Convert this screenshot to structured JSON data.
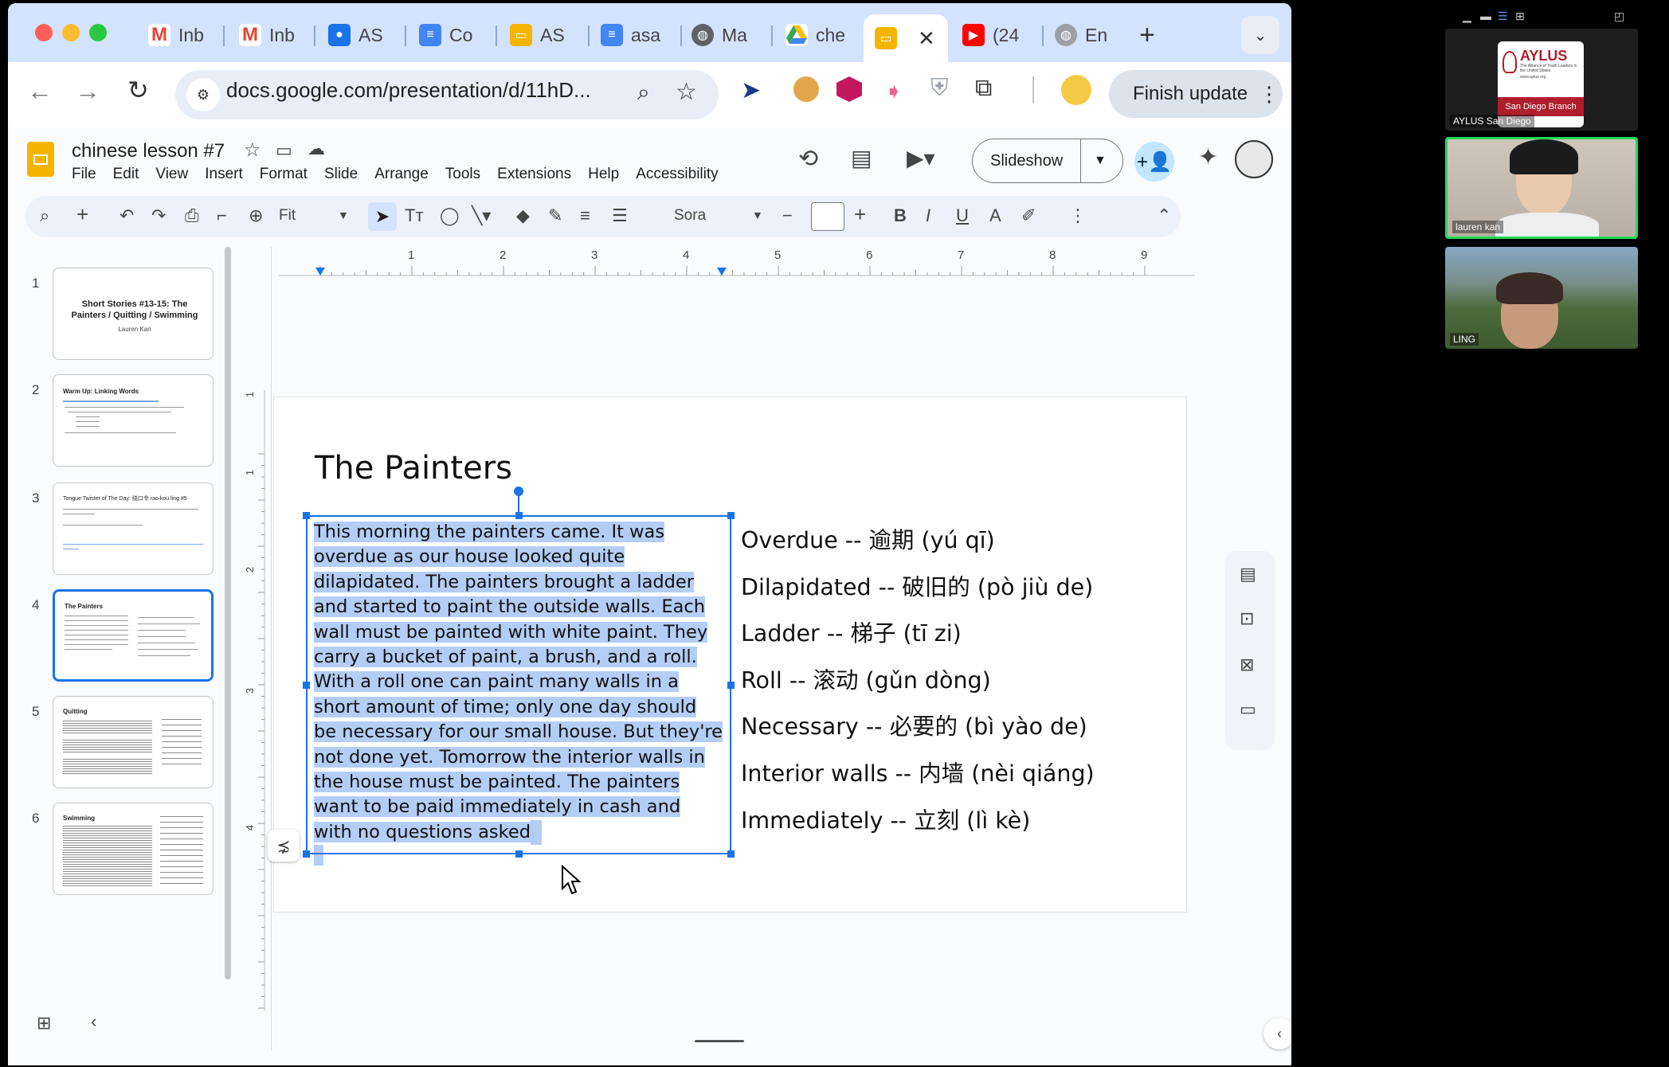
{
  "browser": {
    "tabs": [
      {
        "label": "Inb",
        "icon": "gmail-icon"
      },
      {
        "label": "Inb",
        "icon": "gmail-icon"
      },
      {
        "label": "AS",
        "icon": "contacts-icon"
      },
      {
        "label": "Co",
        "icon": "docs-icon"
      },
      {
        "label": "AS",
        "icon": "slides-icon"
      },
      {
        "label": "asa",
        "icon": "docs-icon"
      },
      {
        "label": "Ma",
        "icon": "globe-icon"
      },
      {
        "label": "che",
        "icon": "drive-icon"
      },
      {
        "label": "",
        "icon": "slides-icon",
        "active": true
      },
      {
        "label": "(24",
        "icon": "youtube-icon"
      },
      {
        "label": "En",
        "icon": "globe-icon"
      }
    ],
    "url": "docs.google.com/presentation/d/11hD...",
    "finish_update": "Finish update"
  },
  "app": {
    "title": "chinese lesson #7",
    "menu": [
      "File",
      "Edit",
      "View",
      "Insert",
      "Format",
      "Slide",
      "Arrange",
      "Tools",
      "Extensions",
      "Help",
      "Accessibility"
    ],
    "slideshow_label": "Slideshow",
    "toolbar": {
      "zoom": "Fit",
      "font": "Sora"
    }
  },
  "ruler": {
    "h_ticks": [
      "1",
      "2",
      "3",
      "4",
      "5",
      "6",
      "7",
      "8",
      "9"
    ],
    "v_ticks": [
      "1",
      "1",
      "2",
      "3",
      "4"
    ]
  },
  "filmstrip": [
    {
      "num": "1",
      "title": "Short Stories #13-15: The Painters / Quitting / Swimming",
      "subtitle": "Lauren Kan"
    },
    {
      "num": "2",
      "title": "Warm Up: Linking Words"
    },
    {
      "num": "3",
      "title": "Tongue Twister of The Day: 绕口令 rao kou ling #5"
    },
    {
      "num": "4",
      "title": "The Painters"
    },
    {
      "num": "5",
      "title": "Quitting"
    },
    {
      "num": "6",
      "title": "Swimming"
    }
  ],
  "slide": {
    "title": "The Painters",
    "body_lines": [
      "This morning the painters came. It was",
      "overdue as our house looked quite",
      "dilapidated. The painters brought a ladder",
      "and started to paint the outside walls. Each",
      "wall must be painted with white paint. They",
      "carry a bucket of paint, a brush, and a roll.",
      "With a roll one can paint many walls in a",
      "short amount of time; only one day should",
      "be necessary for our small house. But they're",
      "not done yet. Tomorrow the interior walls in",
      "the house must be painted. The painters",
      "want to be paid immediately in cash and",
      "with no questions asked"
    ],
    "vocab": [
      "Overdue -- 逾期 (yú qī)",
      "Dilapidated -- 破旧的 (pò jiù de)",
      "Ladder -- 梯子 (tī zi)",
      "Roll -- 滚动 (gǔn dòng)",
      "Necessary -- 必要的 (bì yào de)",
      "Interior walls -- 内墙 (nèi qiáng)",
      "Immediately -- 立刻 (lì kè)"
    ]
  },
  "video": {
    "tiles": [
      {
        "name": "AYLUS San Diego",
        "logo_text": "AYLUS",
        "logo_sub": "The Alliance of Youth Leaders in the United States",
        "branch": "San Diego Branch",
        "site": "www.aylus.org"
      },
      {
        "name": "lauren kan"
      },
      {
        "name": "LING"
      }
    ]
  },
  "colors": {
    "accent": "#1a73e8",
    "highlight": "#b4cdf5",
    "tabstrip": "#d3e3fd",
    "aylus_red": "#b01e2c"
  }
}
